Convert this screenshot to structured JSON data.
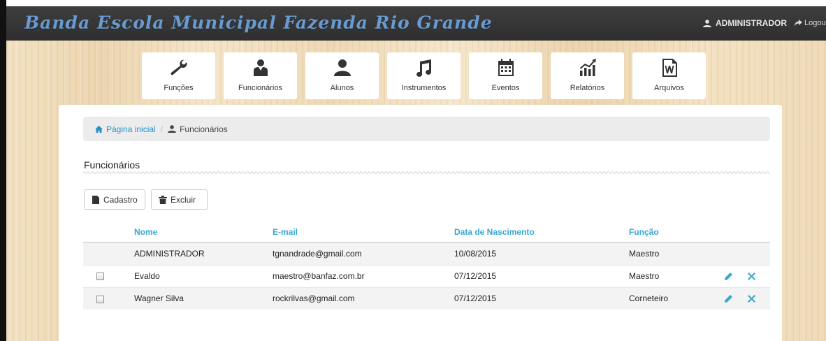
{
  "header": {
    "brand": "Banda Escola Municipal Fazenda Rio Grande",
    "user_name": "ADMINISTRADOR",
    "logout_label": "Logout"
  },
  "menu": [
    {
      "label": "Funções",
      "icon": "wrench-icon"
    },
    {
      "label": "Funcionários",
      "icon": "staff-icon"
    },
    {
      "label": "Alunos",
      "icon": "user-icon"
    },
    {
      "label": "Instrumentos",
      "icon": "music-note-icon"
    },
    {
      "label": "Eventos",
      "icon": "calendar-icon"
    },
    {
      "label": "Relatórios",
      "icon": "stats-icon"
    },
    {
      "label": "Arquivos",
      "icon": "word-file-icon"
    }
  ],
  "breadcrumb": {
    "home": "Página inicial",
    "current": "Funcionários"
  },
  "page": {
    "title": "Funcionários",
    "cadastro_label": "Cadastro",
    "excluir_label": "Excluir"
  },
  "table": {
    "headers": [
      "Nome",
      "E-mail",
      "Data de Nascimento",
      "Função"
    ],
    "rows": [
      {
        "nome": "ADMINISTRADOR",
        "email": "tgnandrade@gmail.com",
        "data": "10/08/2015",
        "funcao": "Maestro"
      },
      {
        "nome": "Evaldo",
        "email": "maestro@banfaz.com.br",
        "data": "07/12/2015",
        "funcao": "Maestro"
      },
      {
        "nome": "Wagner Silva",
        "email": "rockrilvas@gmail.com",
        "data": "07/12/2015",
        "funcao": "Corneteiro"
      }
    ]
  },
  "colors": {
    "accent": "#3aa6d2",
    "navbar": "#333333",
    "brand": "#6a9bd0"
  }
}
